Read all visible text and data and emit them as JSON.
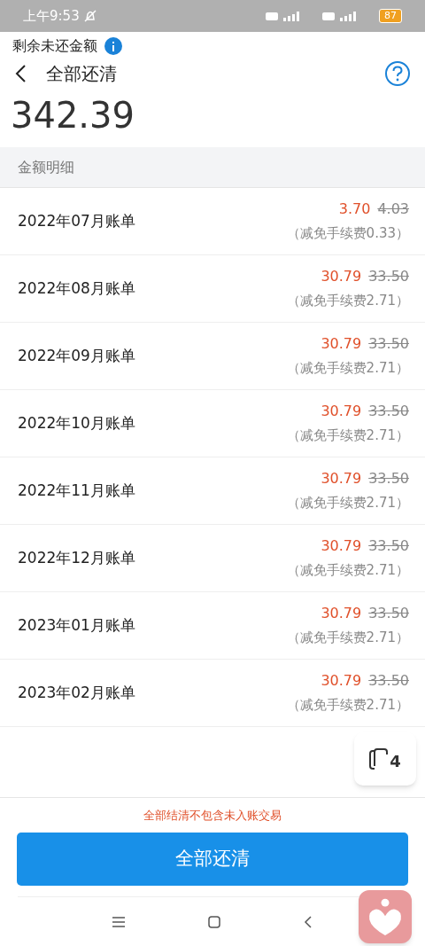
{
  "status_bar": {
    "time": "上午9:53",
    "battery": "87"
  },
  "summary": {
    "label": "剩余未还金额",
    "amount": "342.39"
  },
  "nav": {
    "title": "全部还清"
  },
  "section_title": "金额明细",
  "bills": [
    {
      "title": "2022年07月账单",
      "amount": "3.70",
      "original": "4.03",
      "waiver": "（减免手续费0.33）"
    },
    {
      "title": "2022年08月账单",
      "amount": "30.79",
      "original": "33.50",
      "waiver": "（减免手续费2.71）"
    },
    {
      "title": "2022年09月账单",
      "amount": "30.79",
      "original": "33.50",
      "waiver": "（减免手续费2.71）"
    },
    {
      "title": "2022年10月账单",
      "amount": "30.79",
      "original": "33.50",
      "waiver": "（减免手续费2.71）"
    },
    {
      "title": "2022年11月账单",
      "amount": "30.79",
      "original": "33.50",
      "waiver": "（减免手续费2.71）"
    },
    {
      "title": "2022年12月账单",
      "amount": "30.79",
      "original": "33.50",
      "waiver": "（减免手续费2.71）"
    },
    {
      "title": "2023年01月账单",
      "amount": "30.79",
      "original": "33.50",
      "waiver": "（减免手续费2.71）"
    },
    {
      "title": "2023年02月账单",
      "amount": "30.79",
      "original": "33.50",
      "waiver": "（减免手续费2.71）"
    }
  ],
  "footer": {
    "notice": "全部结清不包含未入账交易",
    "button": "全部还清"
  },
  "floating_badge": {
    "count": "4"
  }
}
